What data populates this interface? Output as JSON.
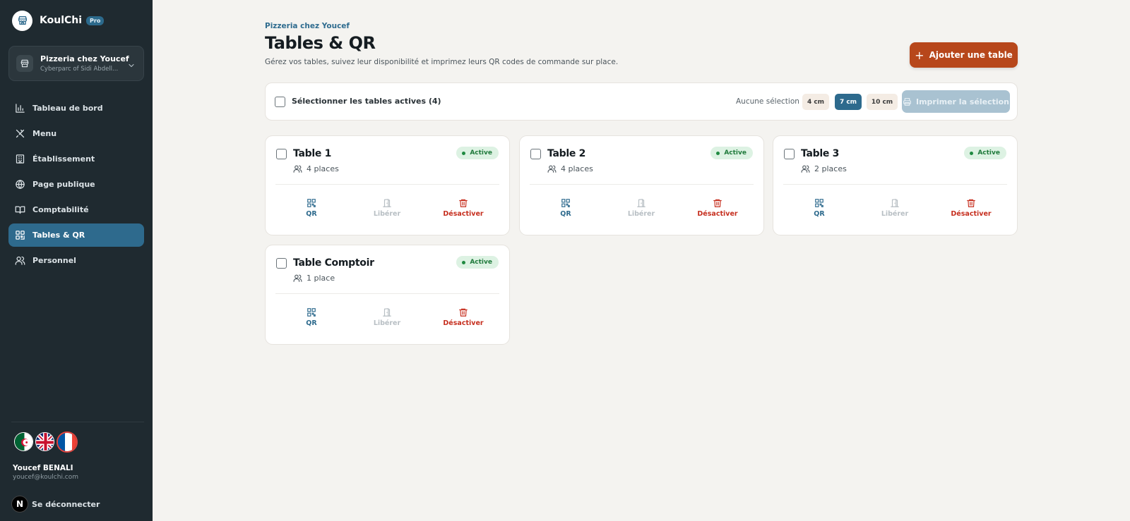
{
  "sidebar": {
    "brand": "KoulChi",
    "plan_badge": "Pro",
    "org": {
      "name": "Pizzeria chez Youcef",
      "address": "Cyberparc of Sidi Abdell..."
    },
    "nav": [
      {
        "label": "Tableau de bord",
        "icon": "chart-bar-icon",
        "active": false
      },
      {
        "label": "Menu",
        "icon": "utensils-icon",
        "active": false
      },
      {
        "label": "Établissement",
        "icon": "building-icon",
        "active": false
      },
      {
        "label": "Page publique",
        "icon": "globe-icon",
        "active": false
      },
      {
        "label": "Comptabilité",
        "icon": "book-icon",
        "active": false
      },
      {
        "label": "Tables & QR",
        "icon": "qr-grid-icon",
        "active": true
      },
      {
        "label": "Personnel",
        "icon": "users-icon",
        "active": false
      }
    ],
    "languages": [
      "dz",
      "gb",
      "fr"
    ],
    "user": {
      "name": "Youcef BENALI",
      "email": "youcef@koulchi.com"
    },
    "logout": {
      "avatar": "N",
      "label": "Se déconnecter"
    }
  },
  "header": {
    "breadcrumb": "Pizzeria chez Youcef",
    "title": "Tables & QR",
    "description": "Gérez vos tables, suivez leur disponibilité et imprimez leurs QR codes de commande sur place.",
    "add_button": "Ajouter une table"
  },
  "toolbar": {
    "select_label": "Sélectionner les tables actives (4)",
    "selection_status": "Aucune sélection",
    "sizes": [
      {
        "label": "4 cm",
        "selected": false
      },
      {
        "label": "7 cm",
        "selected": true
      },
      {
        "label": "10 cm",
        "selected": false
      }
    ],
    "print_button": "Imprimer la sélection"
  },
  "tables": [
    {
      "name": "Table 1",
      "seats": "4 places",
      "status": "Active"
    },
    {
      "name": "Table 2",
      "seats": "4 places",
      "status": "Active"
    },
    {
      "name": "Table 3",
      "seats": "2 places",
      "status": "Active"
    },
    {
      "name": "Table Comptoir",
      "seats": "1 place",
      "status": "Active"
    }
  ],
  "card_actions": {
    "qr": "QR",
    "free": "Libérer",
    "deactivate": "Désactiver"
  },
  "colors": {
    "sidebar_bg": "#1f2a30",
    "accent": "#2e6a8d",
    "primary_action": "#b7471b",
    "danger": "#c62f1f",
    "success": "#1f7a3b",
    "page_bg": "#f4f3f0"
  }
}
